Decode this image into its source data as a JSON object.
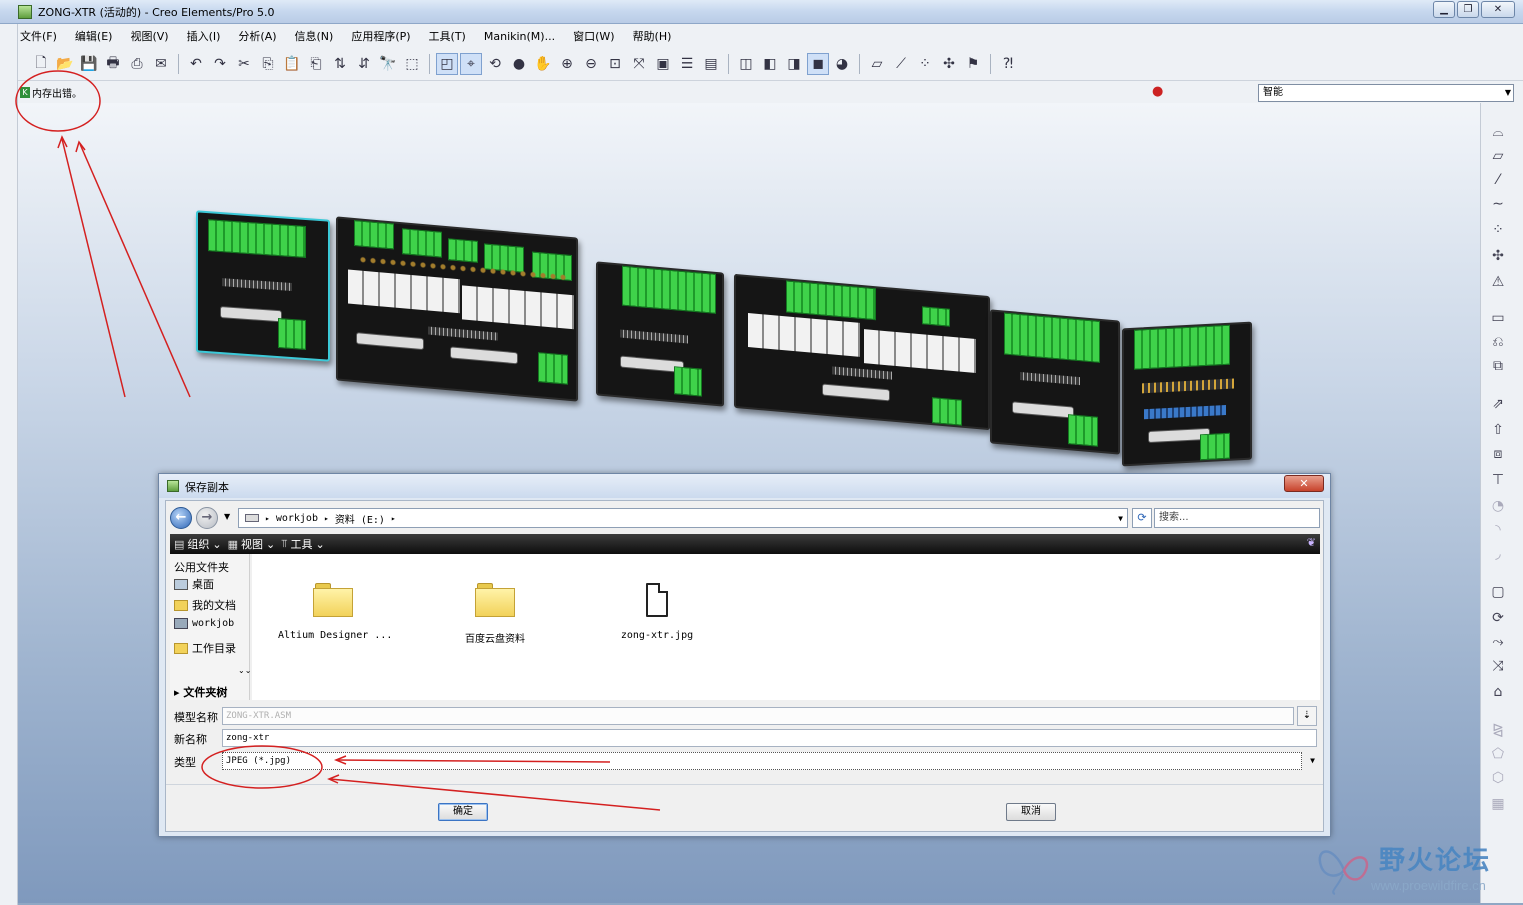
{
  "window": {
    "title": "ZONG-XTR (活动的) - Creo Elements/Pro 5.0",
    "min_label": "▁",
    "max_label": "❐",
    "close_label": "✕"
  },
  "menu": {
    "items": [
      {
        "label": "文件(F)"
      },
      {
        "label": "编辑(E)"
      },
      {
        "label": "视图(V)"
      },
      {
        "label": "插入(I)"
      },
      {
        "label": "分析(A)"
      },
      {
        "label": "信息(N)"
      },
      {
        "label": "应用程序(P)"
      },
      {
        "label": "工具(T)"
      },
      {
        "label": "Manikin(M)..."
      },
      {
        "label": "窗口(W)"
      },
      {
        "label": "帮助(H)"
      }
    ]
  },
  "message_area": {
    "message": "内存出错。",
    "filter_value": "智能"
  },
  "dialog": {
    "title": "保存副本",
    "close_label": "✕",
    "address": {
      "crumbs": [
        "workjob",
        "资料 (E:)"
      ],
      "search_placeholder": "搜索..."
    },
    "command_bar": {
      "organize": "组织",
      "views": "视图",
      "tools": "工具"
    },
    "sidebar": {
      "heading": "公用文件夹",
      "items": [
        {
          "label": "桌面",
          "icon": "desktop-icon"
        },
        {
          "label": "我的文档",
          "icon": "documents-icon"
        },
        {
          "label": "workjob",
          "icon": "computer-icon"
        },
        {
          "label": "工作目录",
          "icon": "folder-icon"
        }
      ],
      "folder_tree": "文件夹树"
    },
    "files": [
      {
        "name": "Altium Designer ...",
        "type": "folder"
      },
      {
        "name": "百度云盘资料",
        "type": "folder"
      },
      {
        "name": "zong-xtr.jpg",
        "type": "file"
      }
    ],
    "form": {
      "model_name_label": "模型名称",
      "model_name_value": "ZONG-XTR.ASM",
      "new_name_label": "新名称",
      "new_name_value": "zong-xtr",
      "type_label": "类型",
      "type_value": "JPEG (*.jpg)"
    },
    "ok_label": "确定",
    "cancel_label": "取消"
  },
  "watermark": {
    "text": "野火论坛",
    "url": "www.proewildfire.cn"
  },
  "colors": {
    "annotation": "#d42020",
    "title_bar": "#c6d7ee",
    "graphics_bg": "#9fb4cf"
  }
}
